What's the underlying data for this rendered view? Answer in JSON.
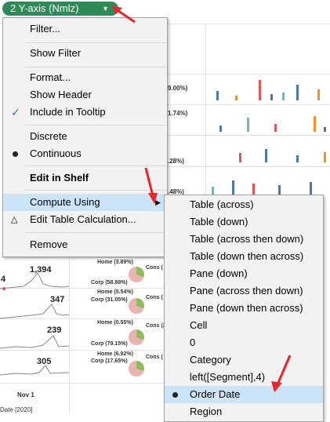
{
  "pill": {
    "label": "2 Y-axis (Nmlz)",
    "arrow_icon": "caret-down"
  },
  "menu": {
    "items": [
      {
        "label": "Filter..."
      },
      {
        "label": "Show Filter"
      },
      {
        "label": "Format..."
      },
      {
        "label": "Show Header"
      },
      {
        "label": "Include in Tooltip",
        "state": "checked"
      },
      {
        "label": "Discrete"
      },
      {
        "label": "Continuous",
        "state": "selected"
      },
      {
        "label": "Edit in Shelf"
      },
      {
        "label": "Compute Using",
        "state": "highlighted"
      },
      {
        "label": "Edit Table Calculation..."
      },
      {
        "label": "Remove"
      }
    ]
  },
  "submenu": {
    "items": [
      {
        "label": "Table (across)"
      },
      {
        "label": "Table (down)"
      },
      {
        "label": "Table (across then down)"
      },
      {
        "label": "Table (down then across)"
      },
      {
        "label": "Pane (down)"
      },
      {
        "label": "Pane (across then down)"
      },
      {
        "label": "Pane (down then across)"
      },
      {
        "label": "Cell"
      },
      {
        "label": "0"
      },
      {
        "label": "Category"
      },
      {
        "label": "left([Segment],4)"
      },
      {
        "label": "Order Date",
        "state": "selected"
      },
      {
        "label": "Region"
      }
    ]
  },
  "background": {
    "pct_labels": [
      "9.00%)",
      "1.74%)",
      ".28%)",
      ".48%)"
    ],
    "numbers": [
      "1,394",
      "347",
      "239",
      "305"
    ],
    "left_partial": "4",
    "pie_rows": [
      {
        "home": "Home (3.89%)",
        "corp": "Corp (58.88%)",
        "cons": "Cons ("
      },
      {
        "home": "Home (5.54%)",
        "corp": "Corp (31.05%)",
        "cons": "Cons ("
      },
      {
        "home": "Home (0.55%)",
        "corp": "Corp (79.15%)",
        "cons": "Cons (2"
      },
      {
        "home": "Home (6.92%)",
        "corp": "Corp (17.65%)",
        "cons": "Cons ("
      }
    ],
    "footer_tick": "Nov 1",
    "footer_partial": "Date [2020]"
  },
  "colors": {
    "pill_bg": "#2e8b57",
    "highlight": "#cce4f7",
    "check": "#2f6cb5",
    "annotation": "#e8262a"
  }
}
